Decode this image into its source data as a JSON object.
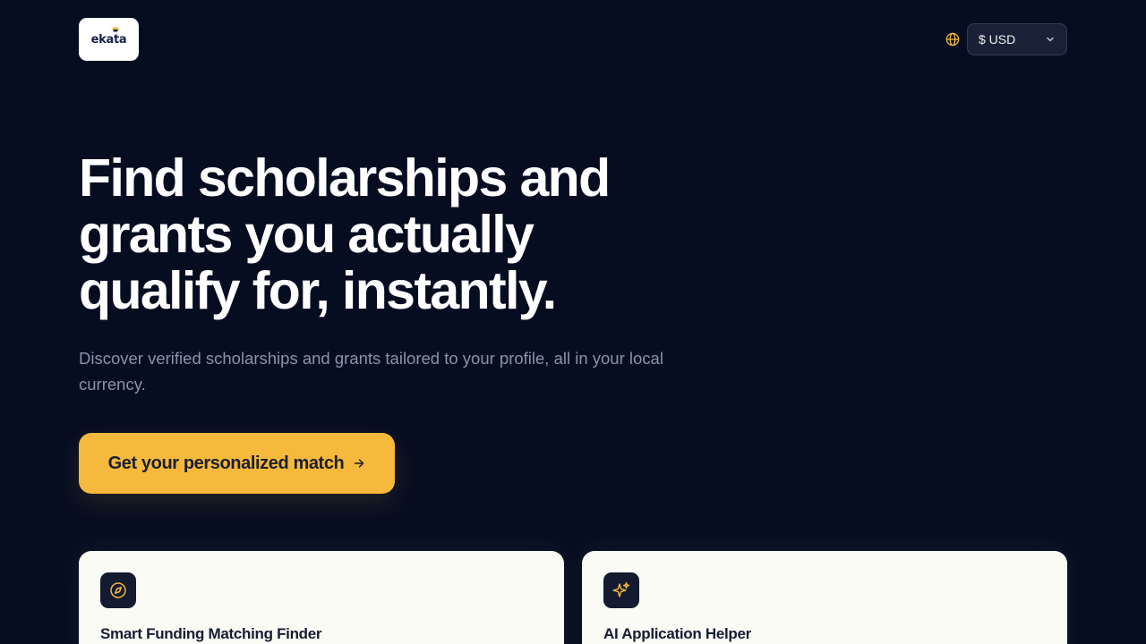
{
  "header": {
    "logo": {
      "text": "ekata"
    },
    "currency": {
      "selected": "$ USD"
    },
    "icons": {
      "globe": "globe-icon",
      "chevron": "chevron-down-icon"
    }
  },
  "hero": {
    "title": "Find scholarships and grants you actually qualify for, instantly.",
    "subtitle": "Discover verified scholarships and grants tailored to your profile, all in your local currency.",
    "cta_label": "Get your personalized match",
    "cta_icon": "arrow-right-icon"
  },
  "features": [
    {
      "title": "Smart Funding Matching Finder",
      "icon": "compass-icon"
    },
    {
      "title": "AI Application Helper",
      "icon": "sparkles-icon"
    }
  ],
  "colors": {
    "background": "#070d21",
    "accent": "#f6b93b",
    "card": "#fbfbf5",
    "icon_tile": "#141a30"
  }
}
